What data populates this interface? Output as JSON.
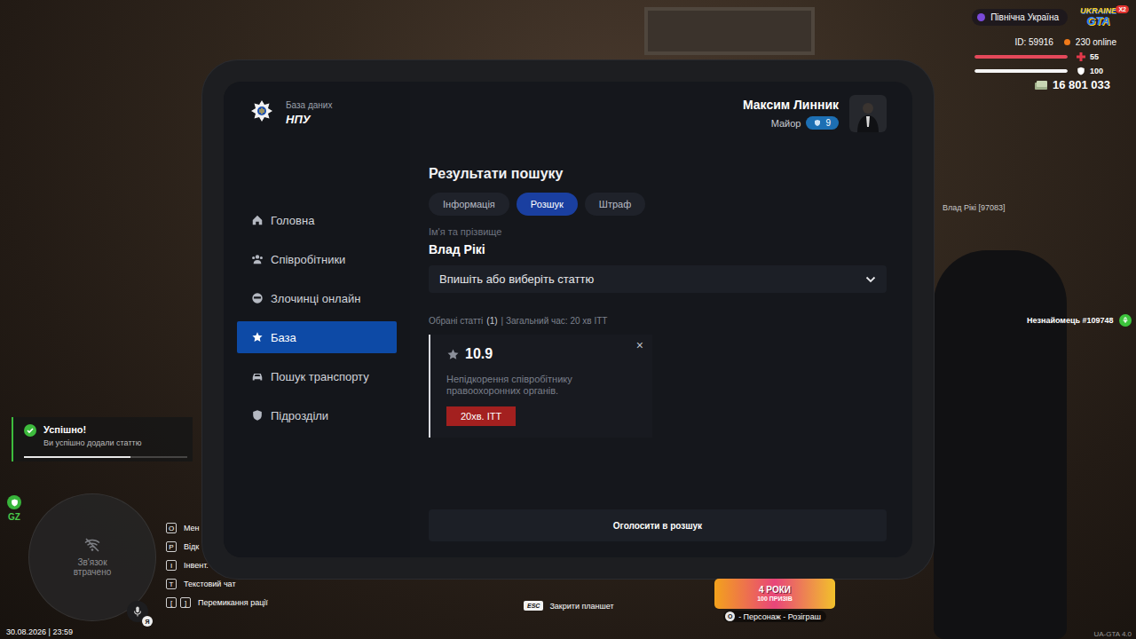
{
  "scene": {
    "nametags": [
      {
        "name": "Влад Рікі [97083]",
        "speaking": false
      },
      {
        "name": "Незнайомець #109748",
        "speaking": true
      }
    ]
  },
  "hud": {
    "region": "Північна Україна",
    "logo": {
      "lines": [
        "UKRAINE",
        "GTA"
      ],
      "badge": "X2"
    },
    "player_id": "ID: 59916",
    "online": "230 online",
    "health": {
      "value": "55",
      "level": 1.0
    },
    "armor": {
      "value": "100",
      "level": 1.0
    },
    "money": "16 801 033",
    "zone": "GZ",
    "minimap": {
      "status": "Зв'язок втрачено"
    },
    "mic": {
      "badge": "Я"
    },
    "hints": [
      {
        "keys": [
          "O"
        ],
        "label": "Мен"
      },
      {
        "keys": [
          "P"
        ],
        "label": "Відк"
      },
      {
        "keys": [
          "I"
        ],
        "label": "Інвент."
      },
      {
        "keys": [
          "T"
        ],
        "label": "Текстовий чат"
      },
      {
        "keys": [
          "[",
          "]"
        ],
        "label": "Перемикання рації"
      }
    ],
    "close_hint": {
      "key": "ESC",
      "label": "Закрити планшет"
    },
    "promo": {
      "title": "4 РОКИ",
      "subtitle": "100 ПРИЗІВ",
      "key": "O",
      "label": "- Персонаж - Розіграш"
    },
    "date_time": "30.08.2026 | 23:59",
    "version": "UA-GTA 4.0"
  },
  "notification": {
    "title": "Успішно!",
    "message": "Ви успішно додали статтю",
    "level": 0.65
  },
  "tablet": {
    "app": {
      "subtitle": "База даних",
      "title": "НПУ"
    },
    "user": {
      "name": "Максим Линник",
      "rank": "Майор",
      "level": "9"
    },
    "sidebar": {
      "items": [
        {
          "label": "Головна",
          "selected": false
        },
        {
          "label": "Співробітники",
          "selected": false
        },
        {
          "label": "Злочинці онлайн",
          "selected": false
        },
        {
          "label": "База",
          "selected": true
        },
        {
          "label": "Пошук транспорту",
          "selected": false
        },
        {
          "label": "Підрозділи",
          "selected": false
        }
      ]
    },
    "page_title": "Результати пошуку",
    "tabs": [
      {
        "label": "Інформація",
        "selected": false
      },
      {
        "label": "Розшук",
        "selected": true
      },
      {
        "label": "Штраф",
        "selected": false
      }
    ],
    "person": {
      "label": "Ім'я та прізвище",
      "name": "Влад Рікі"
    },
    "article_select": {
      "placeholder": "Впишіть або виберіть статтю",
      "expanded": false
    },
    "summary": {
      "label": "Обрані статті",
      "count": "(1)",
      "total": "| Загальний час: 20 хв ІТТ"
    },
    "articles": [
      {
        "code": "10.9",
        "description": "Непідкорення співробітнику правоохоронних органів.",
        "penalty": "20хв. ІТТ",
        "color": "#a3201f",
        "remove": "×"
      }
    ],
    "submit": "Оголосити в розшук"
  }
}
